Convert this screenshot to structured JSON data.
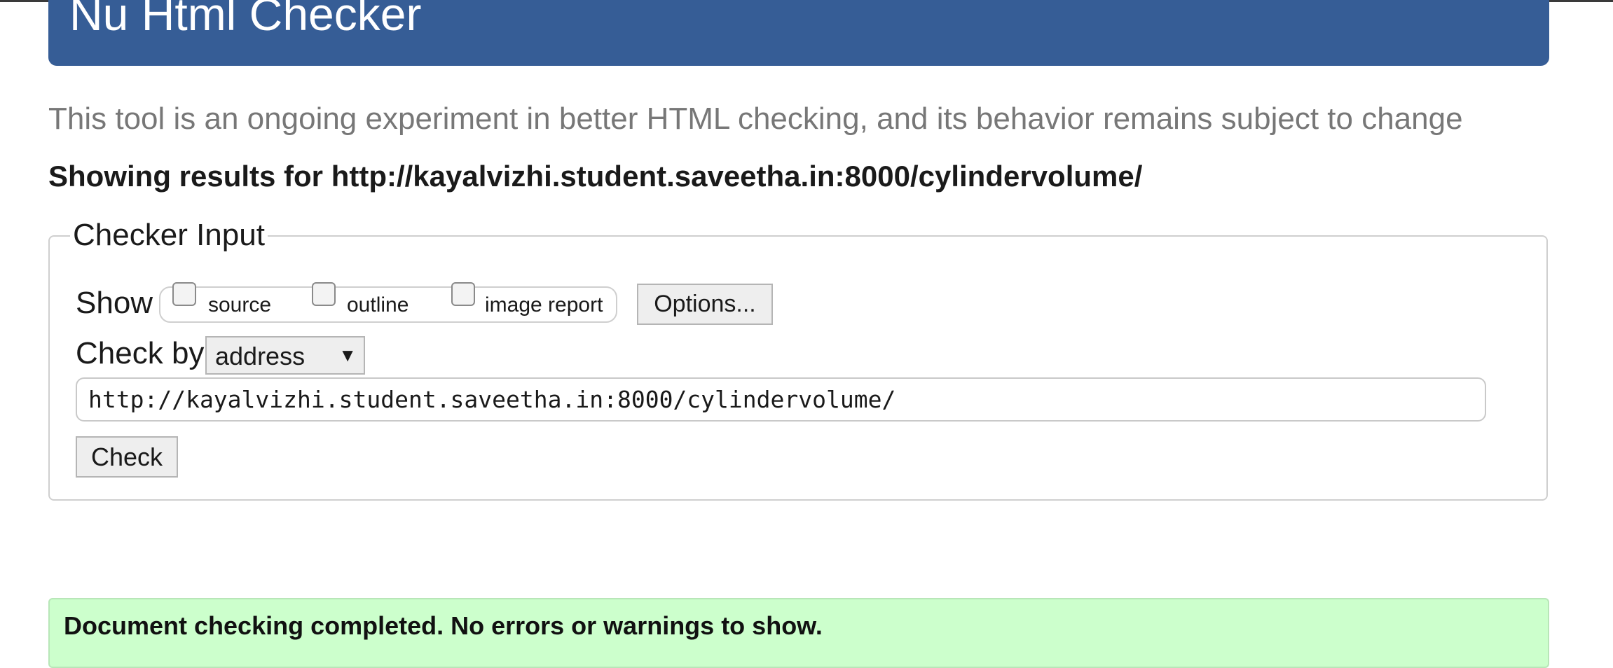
{
  "header": {
    "title": "Nu Html Checker"
  },
  "tagline": "This tool is an ongoing experiment in better HTML checking, and its behavior remains subject to change",
  "results_heading": "Showing results for http://kayalvizhi.student.saveetha.in:8000/cylindervolume/",
  "checker_input": {
    "legend": "Checker Input",
    "show_label": "Show",
    "show_options": [
      {
        "label": "source",
        "checked": false
      },
      {
        "label": "outline",
        "checked": false
      },
      {
        "label": "image report",
        "checked": false
      }
    ],
    "options_button": "Options...",
    "check_by_label": "Check by",
    "check_by_selected": "address",
    "select_arrow_icon": "triangle-down-icon",
    "url_value": "http://kayalvizhi.student.saveetha.in:8000/cylindervolume/",
    "check_button": "Check"
  },
  "status": {
    "message": "Document checking completed. No errors or warnings to show."
  },
  "colors": {
    "banner": "#365d96",
    "success_background": "#ccffcc",
    "tagline": "#777777"
  }
}
